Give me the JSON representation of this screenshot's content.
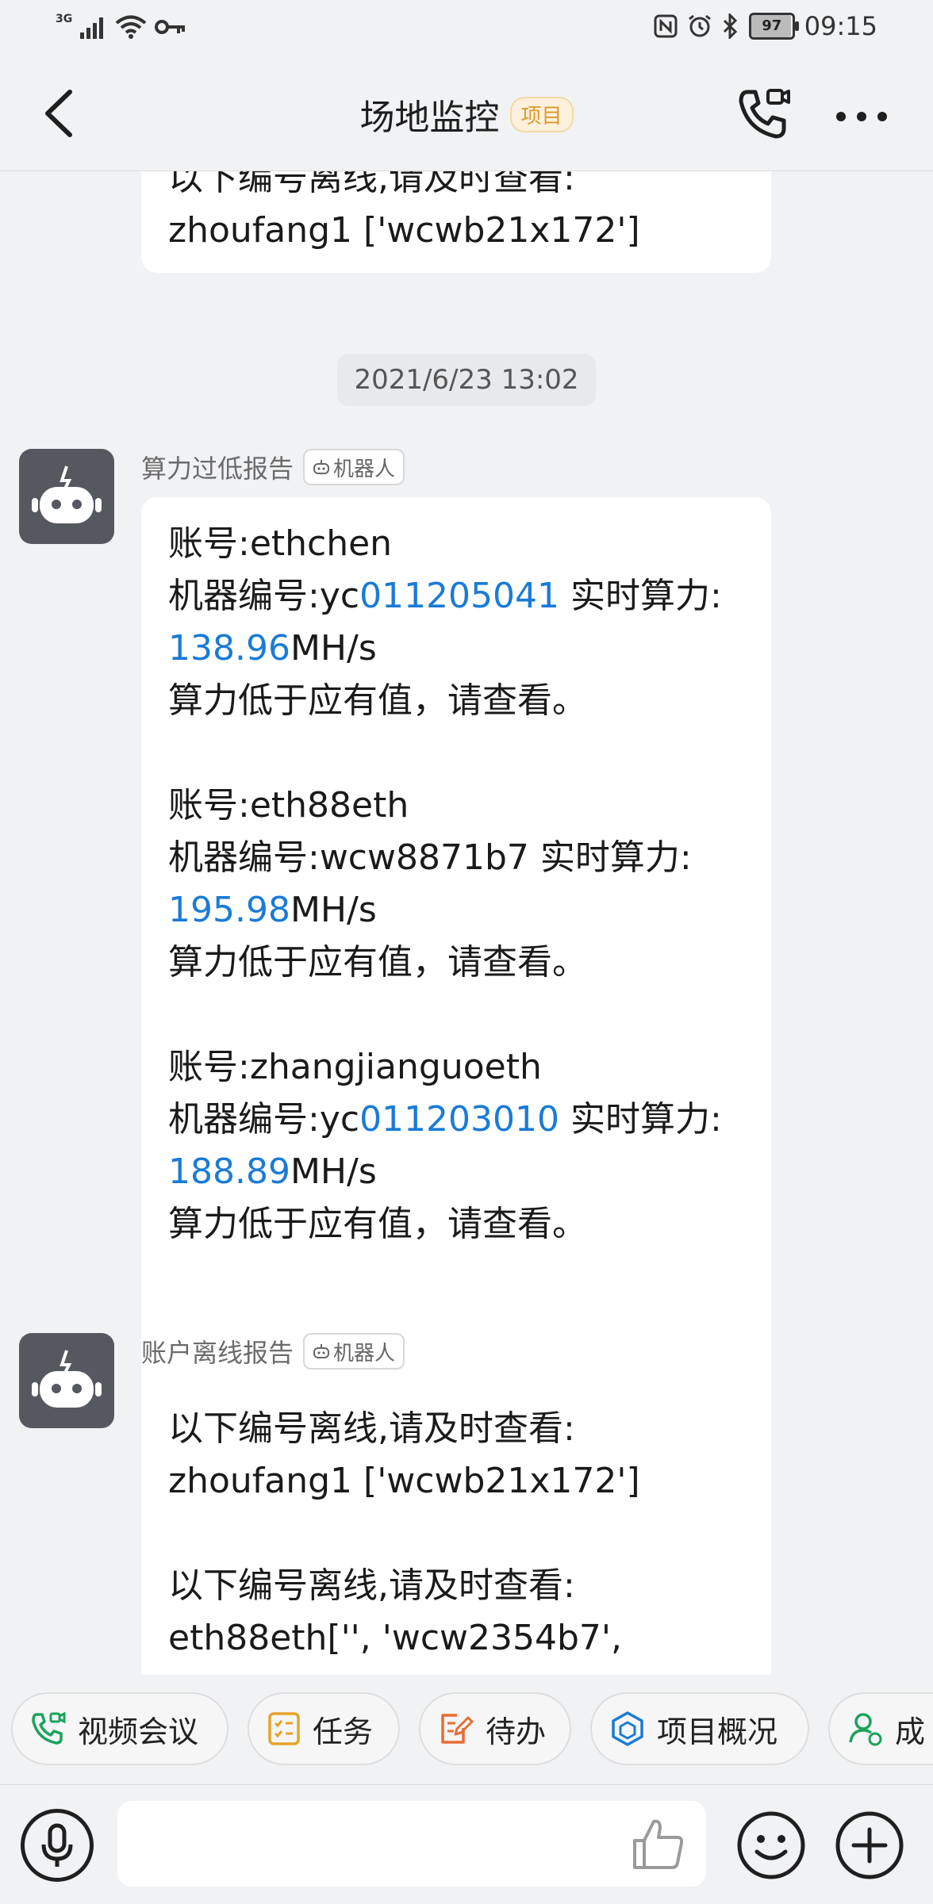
{
  "status_bar": {
    "network": "3G",
    "battery": "97",
    "battery_level": 0.97,
    "time": "09:15"
  },
  "header": {
    "title": "场地监控",
    "tag": "项目"
  },
  "chat": {
    "top_message": {
      "line1": "以下编号离线,请及时查看:",
      "line2": "zhoufang1 ['wcwb21x172']"
    },
    "timestamp": "2021/6/23 13:02",
    "message1": {
      "sender": "算力过低报告",
      "badge": "机器人",
      "entries": [
        {
          "account": "账号:ethchen",
          "machine_prefix": "机器编号:yc",
          "machine_number": "011205041",
          "realtime_label": " 实时算力:",
          "hashrate": "138.96",
          "unit": "MH/s",
          "note": "算力低于应有值，请查看。"
        },
        {
          "account": "账号:eth88eth",
          "machine_prefix": "机器编号:wcw8871b7 实时算力:",
          "machine_number": "",
          "realtime_label": "",
          "hashrate": "195.98",
          "unit": "MH/s",
          "note": "算力低于应有值，请查看。"
        },
        {
          "account": "账号:zhangjianguoeth",
          "machine_prefix": "机器编号:yc",
          "machine_number": "011203010",
          "realtime_label": " 实时算力:",
          "hashrate": "188.89",
          "unit": "MH/s",
          "note": "算力低于应有值，请查看。"
        }
      ]
    },
    "message2": {
      "sender": "账户离线报告",
      "badge": "机器人",
      "line1": "以下编号离线,请及时查看:",
      "line2": "zhoufang1 ['wcwb21x172']",
      "line3": "以下编号离线,请及时查看:",
      "line4": "eth88eth['', 'wcw2354b7',"
    }
  },
  "quick_actions": [
    {
      "label": "视频会议",
      "icon": "video-phone-icon"
    },
    {
      "label": "任务",
      "icon": "task-list-icon"
    },
    {
      "label": "待办",
      "icon": "todo-edit-icon"
    },
    {
      "label": "项目概况",
      "icon": "cube-icon"
    },
    {
      "label": "成",
      "icon": "member-icon"
    }
  ],
  "input": {
    "placeholder": ""
  },
  "colors": {
    "link_blue": "#1a7bd6",
    "project_tag": "#d99a2b",
    "avatar_bg": "#55595f"
  }
}
